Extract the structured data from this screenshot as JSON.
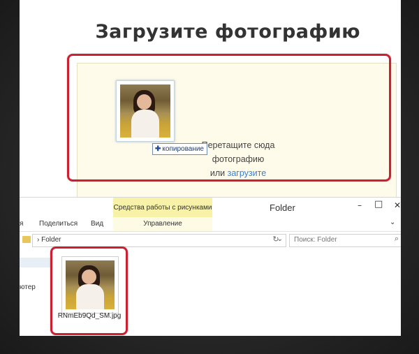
{
  "web": {
    "title": "Загрузите фотографию",
    "drop_line1": "Перетащите сюда",
    "drop_line2": "фотографию",
    "drop_or": "или",
    "drop_link": "загрузите",
    "copy_tooltip": "копирование",
    "copy_icon": "plus-icon"
  },
  "explorer": {
    "title": "Folder",
    "context_tab": "Средства работы с рисунками",
    "ribbon": {
      "item_partial": "я",
      "share": "Поделиться",
      "view": "Вид",
      "manage": "Управление"
    },
    "address": {
      "crumb": "Folder"
    },
    "search_placeholder": "Поиск: Folder",
    "nav_item_partial": "ютер",
    "file": {
      "name": "RNmEb9Qd_SM.jpg"
    }
  },
  "colors": {
    "highlight": "#cc1f2f",
    "drop_bg": "#fefbea",
    "link": "#3a7fd0",
    "context_tab": "#f7f2a8"
  }
}
